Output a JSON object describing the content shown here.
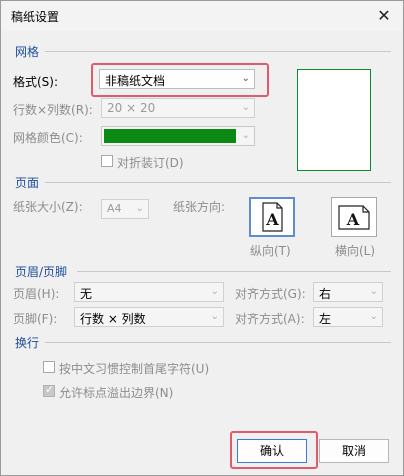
{
  "window": {
    "title": "稿纸设置",
    "close_glyph": "✕"
  },
  "grid": {
    "section_title": "网格",
    "format_label": "格式(S):",
    "format_value": "非稿纸文档",
    "rowscols_label": "行数×列数(R):",
    "rowscols_value": "20 × 20",
    "color_label": "网格颜色(C):",
    "color_value": "#0a8a12",
    "fold_label": "对折装订(D)"
  },
  "page": {
    "section_title": "页面",
    "size_label": "纸张大小(Z):",
    "size_value": "A4",
    "orientation_label": "纸张方向:",
    "portrait_label": "纵向(T)",
    "landscape_label": "横向(L)",
    "orient_glyph": "A"
  },
  "header_footer": {
    "section_title": "页眉/页脚",
    "header_label": "页眉(H):",
    "header_value": "无",
    "header_align_label": "对齐方式(G):",
    "header_align_value": "右",
    "footer_label": "页脚(F):",
    "footer_value": "行数 × 列数",
    "footer_align_label": "对齐方式(A):",
    "footer_align_value": "左"
  },
  "linebreak": {
    "section_title": "换行",
    "option1_label": "按中文习惯控制首尾字符(U)",
    "option2_label": "允许标点溢出边界(N)"
  },
  "buttons": {
    "ok": "确认",
    "cancel": "取消"
  },
  "colors": {
    "highlight": "#e15a6e",
    "section_title": "#1f4e9a",
    "preview_border": "#0d8a2b"
  }
}
